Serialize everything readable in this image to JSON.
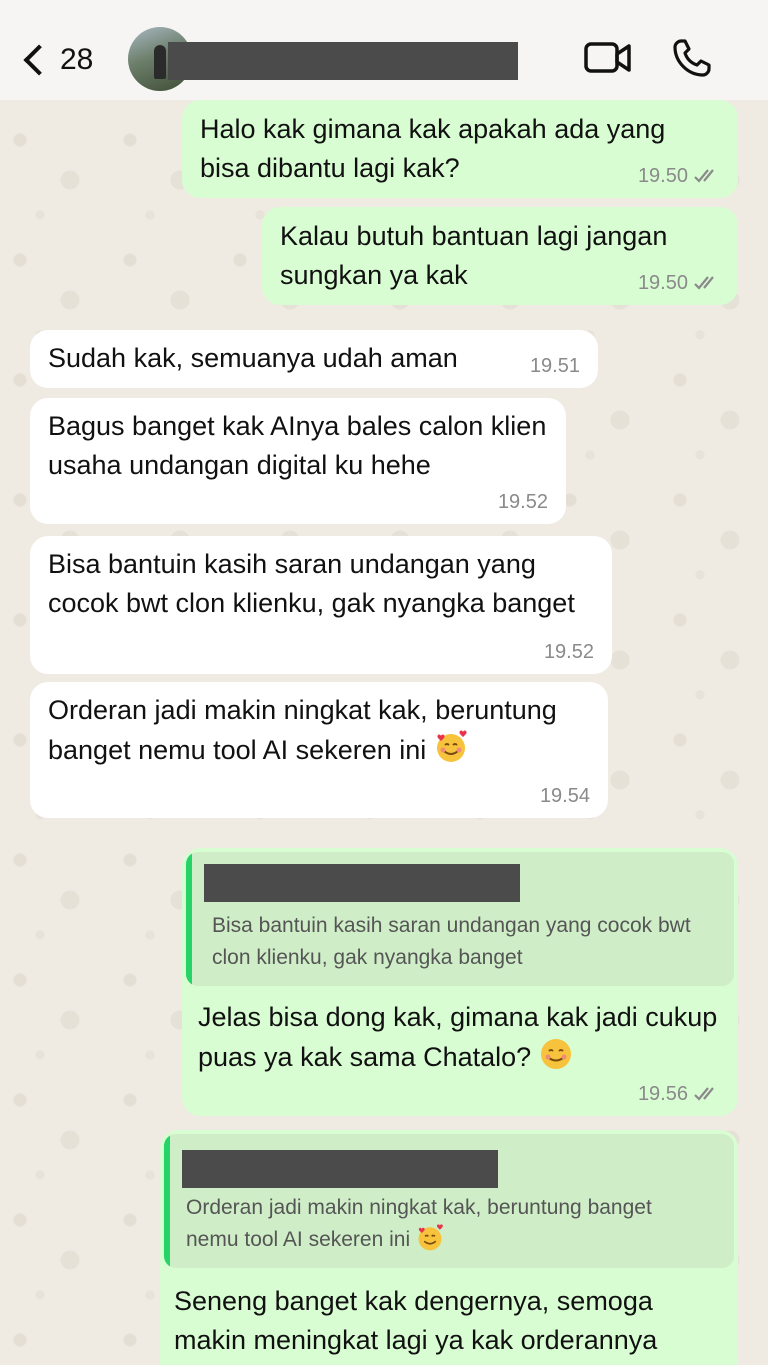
{
  "header": {
    "back_count": "28",
    "contact_name": ""
  },
  "messages": [
    {
      "id": "m1",
      "direction": "out",
      "text": "Halo kak gimana kak apakah ada yang bisa dibantu lagi kak?",
      "time": "19.50",
      "status": "read"
    },
    {
      "id": "m2",
      "direction": "out",
      "text": "Kalau butuh bantuan lagi jangan sungkan ya kak",
      "time": "19.50",
      "status": "read"
    },
    {
      "id": "m3",
      "direction": "in",
      "text": "Sudah kak, semuanya udah aman",
      "time": "19.51"
    },
    {
      "id": "m4",
      "direction": "in",
      "text": "Bagus banget kak AInya bales calon klien usaha undangan digital ku hehe",
      "time": "19.52"
    },
    {
      "id": "m5",
      "direction": "in",
      "text": "Bisa bantuin kasih saran undangan yang cocok bwt clon klienku, gak nyangka banget",
      "time": "19.52"
    },
    {
      "id": "m6",
      "direction": "in",
      "text": "Orderan jadi makin ningkat kak, beruntung banget nemu tool AI sekeren ini",
      "emoji": "smiling-face-with-hearts",
      "time": "19.54"
    },
    {
      "id": "m7",
      "direction": "out",
      "quote_text": "Bisa bantuin kasih saran undangan yang cocok bwt clon klienku, gak nyangka banget",
      "text": "Jelas bisa dong kak, gimana kak jadi cukup puas ya kak sama Chatalo?",
      "emoji": "smiling-face",
      "time": "19.56",
      "status": "read"
    },
    {
      "id": "m8",
      "direction": "out",
      "quote_text": "Orderan jadi makin ningkat kak, beruntung banget nemu tool AI sekeren ini",
      "quote_emoji": "smiling-face-with-hearts",
      "text": "Seneng banget kak dengernya, semoga makin meningkat lagi ya kak orderannya"
    }
  ],
  "colors": {
    "outgoing_bubble": "#d9fdd3",
    "incoming_bubble": "#ffffff",
    "quote_bar": "#25d366",
    "wallpaper": "#efeae2"
  },
  "icons": [
    "chevron-left-icon",
    "video-call-icon",
    "phone-icon",
    "double-check-icon"
  ]
}
